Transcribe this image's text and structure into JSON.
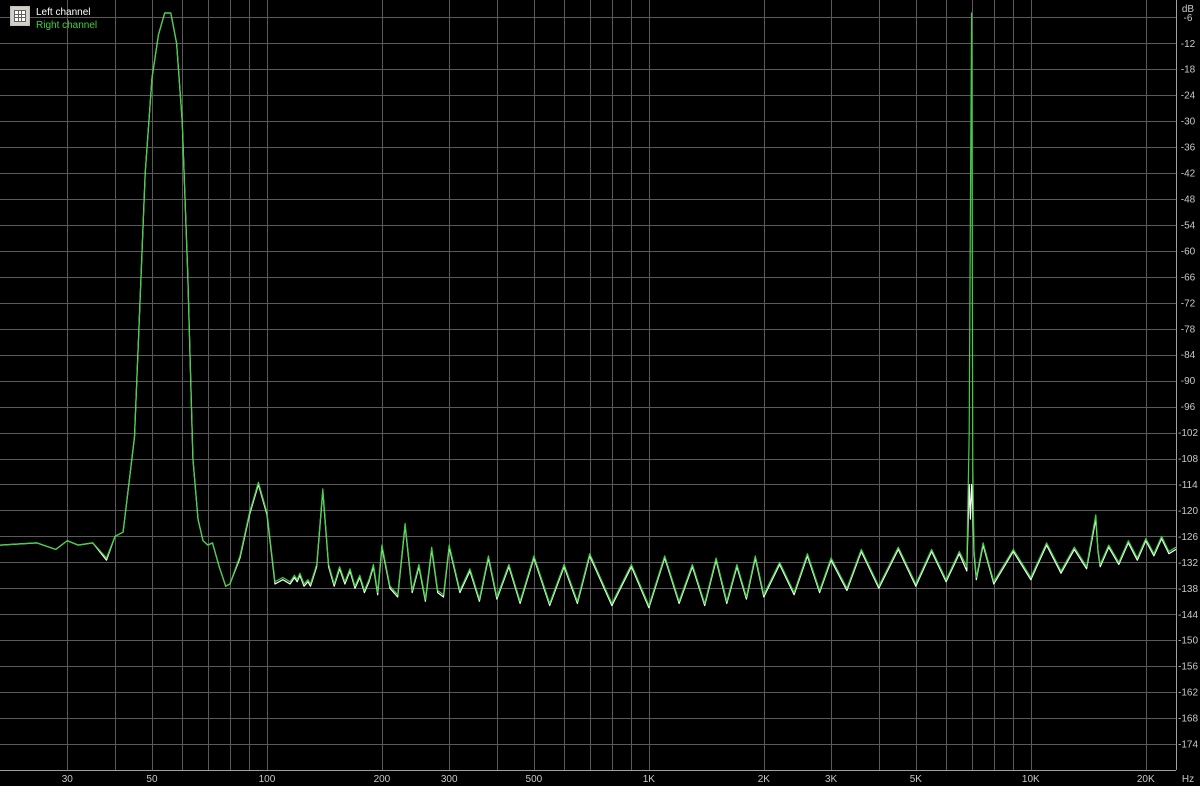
{
  "chart_data": {
    "type": "line",
    "title": "",
    "xlabel": "",
    "ylabel": "",
    "x_unit": "Hz",
    "y_unit": "dB",
    "x_scale": "log",
    "xlim": [
      20,
      24000
    ],
    "ylim": [
      -180,
      -2
    ],
    "x_ticks": [
      {
        "value": 30,
        "label": "30"
      },
      {
        "value": 50,
        "label": "50"
      },
      {
        "value": 100,
        "label": "100"
      },
      {
        "value": 200,
        "label": "200"
      },
      {
        "value": 300,
        "label": "300"
      },
      {
        "value": 500,
        "label": "500"
      },
      {
        "value": 1000,
        "label": "1K"
      },
      {
        "value": 2000,
        "label": "2K"
      },
      {
        "value": 3000,
        "label": "3K"
      },
      {
        "value": 5000,
        "label": "5K"
      },
      {
        "value": 10000,
        "label": "10K"
      },
      {
        "value": 20000,
        "label": "20K"
      }
    ],
    "x_minor_gridlines": [
      40,
      60,
      70,
      80,
      90,
      400,
      600,
      700,
      800,
      900,
      4000,
      6000,
      7000,
      8000,
      9000
    ],
    "y_ticks": [
      -6,
      -12,
      -18,
      -24,
      -30,
      -36,
      -42,
      -48,
      -54,
      -60,
      -66,
      -72,
      -78,
      -84,
      -90,
      -96,
      -102,
      -108,
      -114,
      -120,
      -126,
      -132,
      -138,
      -144,
      -150,
      -156,
      -162,
      -168,
      -174
    ],
    "grid": true,
    "legend_position": "top-left",
    "background_color": "#000000",
    "grid_color": "#5a5a5a",
    "axis_text_color": "#c8c8c8",
    "series": [
      {
        "name": "Left channel",
        "color": "#ffffff",
        "x": [
          20,
          25,
          28,
          30,
          32,
          35,
          38,
          40,
          42,
          45,
          46,
          47,
          48,
          50,
          52,
          54,
          56,
          58,
          60,
          62,
          64,
          66,
          68,
          70,
          72,
          75,
          78,
          80,
          85,
          90,
          95,
          100,
          105,
          110,
          115,
          118,
          120,
          122,
          125,
          128,
          130,
          135,
          140,
          145,
          150,
          155,
          160,
          165,
          170,
          175,
          180,
          185,
          190,
          195,
          200,
          210,
          220,
          230,
          240,
          250,
          260,
          270,
          280,
          290,
          300,
          320,
          340,
          360,
          380,
          400,
          430,
          460,
          500,
          550,
          600,
          650,
          700,
          800,
          900,
          1000,
          1100,
          1200,
          1300,
          1400,
          1500,
          1600,
          1700,
          1800,
          1900,
          2000,
          2200,
          2400,
          2600,
          2800,
          3000,
          3300,
          3600,
          4000,
          4500,
          5000,
          5500,
          6000,
          6500,
          6800,
          6900,
          6950,
          7000,
          7050,
          7100,
          7200,
          7500,
          8000,
          9000,
          10000,
          11000,
          12000,
          13000,
          14000,
          14800,
          15000,
          15200,
          16000,
          17000,
          18000,
          19000,
          20000,
          21000,
          22000,
          23000,
          24000
        ],
        "y": [
          -128,
          -127.5,
          -129,
          -127,
          -128,
          -127.5,
          -131.5,
          -126,
          -125,
          -103,
          -82,
          -62,
          -42,
          -20,
          -10,
          -5,
          -5,
          -12,
          -30,
          -65,
          -108,
          -122,
          -127,
          -128,
          -127.5,
          -133,
          -137.5,
          -137,
          -131,
          -121,
          -114,
          -121,
          -137,
          -136,
          -137,
          -135.5,
          -136.5,
          -135,
          -137.5,
          -136.5,
          -137.5,
          -133,
          -115.5,
          -133,
          -137.5,
          -133.5,
          -137,
          -134,
          -138,
          -135.5,
          -139,
          -136.5,
          -133,
          -139.5,
          -128.5,
          -138,
          -140,
          -123.5,
          -139,
          -133,
          -141,
          -129,
          -139,
          -140,
          -128.5,
          -139,
          -134,
          -141,
          -131,
          -140.5,
          -133,
          -141.5,
          -131,
          -142,
          -133,
          -141.5,
          -130.5,
          -142,
          -133,
          -142.5,
          -131,
          -141.5,
          -133,
          -142,
          -131.5,
          -141.5,
          -133,
          -140.5,
          -131,
          -140,
          -132.5,
          -139.5,
          -130.5,
          -139,
          -131.5,
          -138.5,
          -129.5,
          -138,
          -129,
          -137.5,
          -129.5,
          -136.5,
          -130,
          -134,
          -114,
          -122,
          -114,
          -120,
          -130,
          -136,
          -128,
          -137,
          -129.5,
          -136,
          -128,
          -134.5,
          -129,
          -133.5,
          -122,
          -129.5,
          -133,
          -128.5,
          -132.5,
          -127.5,
          -131.5,
          -127,
          -130.5,
          -126.5,
          -130,
          -129
        ]
      },
      {
        "name": "Right channel",
        "color": "#3fd23f",
        "x": [
          20,
          25,
          28,
          30,
          32,
          35,
          38,
          40,
          42,
          45,
          46,
          47,
          48,
          50,
          52,
          54,
          56,
          58,
          60,
          62,
          64,
          66,
          68,
          70,
          72,
          75,
          78,
          80,
          85,
          90,
          95,
          100,
          105,
          110,
          115,
          118,
          120,
          122,
          125,
          128,
          130,
          135,
          140,
          145,
          150,
          155,
          160,
          165,
          170,
          175,
          180,
          185,
          190,
          195,
          200,
          210,
          220,
          230,
          240,
          250,
          260,
          270,
          280,
          290,
          300,
          320,
          340,
          360,
          380,
          400,
          430,
          460,
          500,
          550,
          600,
          650,
          700,
          800,
          900,
          1000,
          1100,
          1200,
          1300,
          1400,
          1500,
          1600,
          1700,
          1800,
          1900,
          2000,
          2200,
          2400,
          2600,
          2800,
          3000,
          3300,
          3600,
          4000,
          4500,
          5000,
          5500,
          6000,
          6500,
          6800,
          6900,
          6950,
          7000,
          7050,
          7100,
          7200,
          7500,
          8000,
          9000,
          10000,
          11000,
          12000,
          13000,
          14000,
          14800,
          15000,
          15200,
          16000,
          17000,
          18000,
          19000,
          20000,
          21000,
          22000,
          23000,
          24000
        ],
        "y": [
          -128,
          -127.5,
          -129,
          -127,
          -128,
          -127.5,
          -131,
          -126,
          -125,
          -103,
          -82,
          -62,
          -42,
          -20,
          -10,
          -5,
          -5,
          -12,
          -30,
          -65,
          -108,
          -122,
          -127,
          -128,
          -127.5,
          -133,
          -137.5,
          -137,
          -130.5,
          -120.5,
          -113.5,
          -120.5,
          -136.5,
          -135.5,
          -136.5,
          -135,
          -136,
          -134.5,
          -137,
          -136,
          -137,
          -132.5,
          -115,
          -132.5,
          -137,
          -133,
          -136.5,
          -133.5,
          -137.5,
          -135,
          -138.5,
          -136,
          -132.5,
          -139,
          -128,
          -137.5,
          -139.5,
          -123,
          -138.5,
          -132.5,
          -140.5,
          -128.5,
          -138.5,
          -139.5,
          -128,
          -138.5,
          -133.5,
          -140.5,
          -130.5,
          -140,
          -132.5,
          -141,
          -130.5,
          -141.5,
          -132.5,
          -141,
          -130,
          -141.5,
          -132.5,
          -142,
          -130.5,
          -141,
          -132.5,
          -141.5,
          -131,
          -141,
          -132.5,
          -140,
          -130.5,
          -139.5,
          -132,
          -139,
          -130,
          -138.5,
          -131,
          -138,
          -129,
          -137.5,
          -128.5,
          -137,
          -129,
          -136,
          -129.5,
          -133,
          -102,
          -50,
          -5,
          -110,
          -129,
          -135.5,
          -127.5,
          -136.5,
          -129,
          -135.5,
          -127.5,
          -134,
          -128.5,
          -133,
          -121,
          -129,
          -132.5,
          -128,
          -132,
          -127,
          -131,
          -126.5,
          -130,
          -126,
          -129.5,
          -128.5
        ]
      }
    ]
  }
}
